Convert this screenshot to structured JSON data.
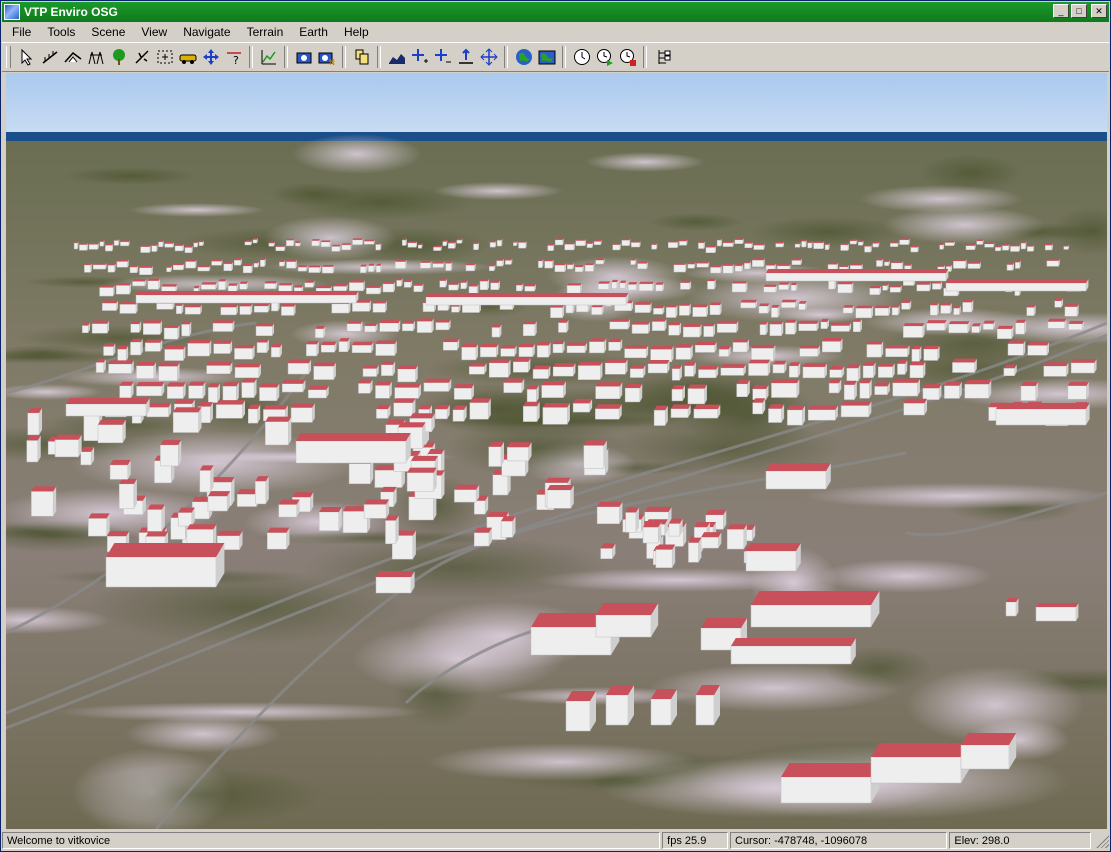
{
  "window": {
    "title": "VTP Enviro OSG",
    "minimize_glyph": "_",
    "maximize_glyph": "□",
    "close_glyph": "✕"
  },
  "menu": [
    "File",
    "Tools",
    "Scene",
    "View",
    "Navigate",
    "Terrain",
    "Earth",
    "Help"
  ],
  "toolbar": {
    "groups": [
      [
        "select-arrow-icon",
        "fence-icon",
        "route-icon",
        "power-line-icon",
        "tree-icon",
        "instances-icon",
        "move-select-icon",
        "vehicle-icon",
        "navigate-icon",
        "query-icon"
      ],
      [
        "terrain-profile-icon"
      ],
      [
        "snapshot-icon",
        "snapshot-numbered-icon"
      ],
      [
        "layers-icon"
      ],
      [
        "fly-terrain-icon",
        "speed-up-icon",
        "speed-down-icon",
        "elevation-up-icon",
        "expand-icon"
      ],
      [
        "earth-globe-icon",
        "earth-map-icon"
      ],
      [
        "time-icon",
        "time-play-icon",
        "time-stop-icon"
      ],
      [
        "scene-graph-icon"
      ]
    ]
  },
  "status": {
    "message": "Welcome to vitkovice",
    "fps": "fps 25.9",
    "cursor": "Cursor: -478748, -1096078",
    "elevation": "Elev: 298.0"
  },
  "colors": {
    "titlebar": "#1c9a2a",
    "sky_top": "#aacbee",
    "sea": "#1a4f8a",
    "roof": "#c8505a",
    "wall": "#eeeeee"
  }
}
